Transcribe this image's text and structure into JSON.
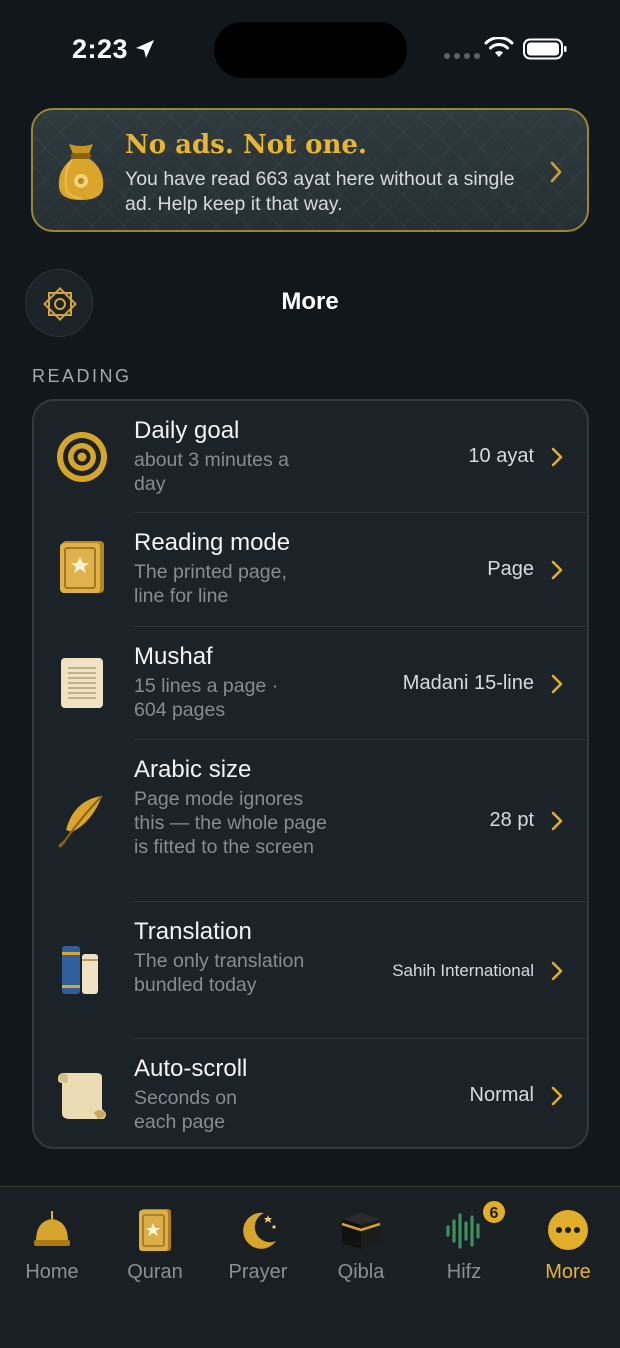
{
  "status_bar": {
    "time": "2:23"
  },
  "banner": {
    "title": "No ads. Not one.",
    "text": "You have read 663 ayat here without a single ad. Help keep it that way."
  },
  "header": {
    "title": "More"
  },
  "section": {
    "label": "READING"
  },
  "settings": [
    {
      "title": "Daily goal",
      "subtitle": "about 3 minutes a day",
      "value": "10 ayat",
      "icon": "target-icon"
    },
    {
      "title": "Reading mode",
      "subtitle": "The printed page, line for line",
      "value": "Page",
      "icon": "book-icon"
    },
    {
      "title": "Mushaf",
      "subtitle": "15 lines a page · 604 pages",
      "value": "Madani 15-line",
      "icon": "page-icon"
    },
    {
      "title": "Arabic size",
      "subtitle": "Page mode ignores this — the whole page is fitted to the screen",
      "value": "28 pt",
      "icon": "feather-icon"
    },
    {
      "title": "Translation",
      "subtitle": "The only translation bundled today",
      "value": "Sahih International",
      "icon": "books-icon"
    },
    {
      "title": "Auto-scroll",
      "subtitle": "Seconds on each page",
      "value": "Normal",
      "icon": "scroll-icon"
    }
  ],
  "tabbar": {
    "tabs": [
      {
        "label": "Home",
        "icon": "mosque-icon"
      },
      {
        "label": "Quran",
        "icon": "quran-icon"
      },
      {
        "label": "Prayer",
        "icon": "crescent-icon"
      },
      {
        "label": "Qibla",
        "icon": "kaaba-icon"
      },
      {
        "label": "Hifz",
        "icon": "waveform-icon",
        "badge": "6"
      },
      {
        "label": "More",
        "icon": "more-icon",
        "active": true
      }
    ]
  },
  "colors": {
    "accent": "#e6b430",
    "background": "#12171c",
    "card": "#1b2228"
  }
}
